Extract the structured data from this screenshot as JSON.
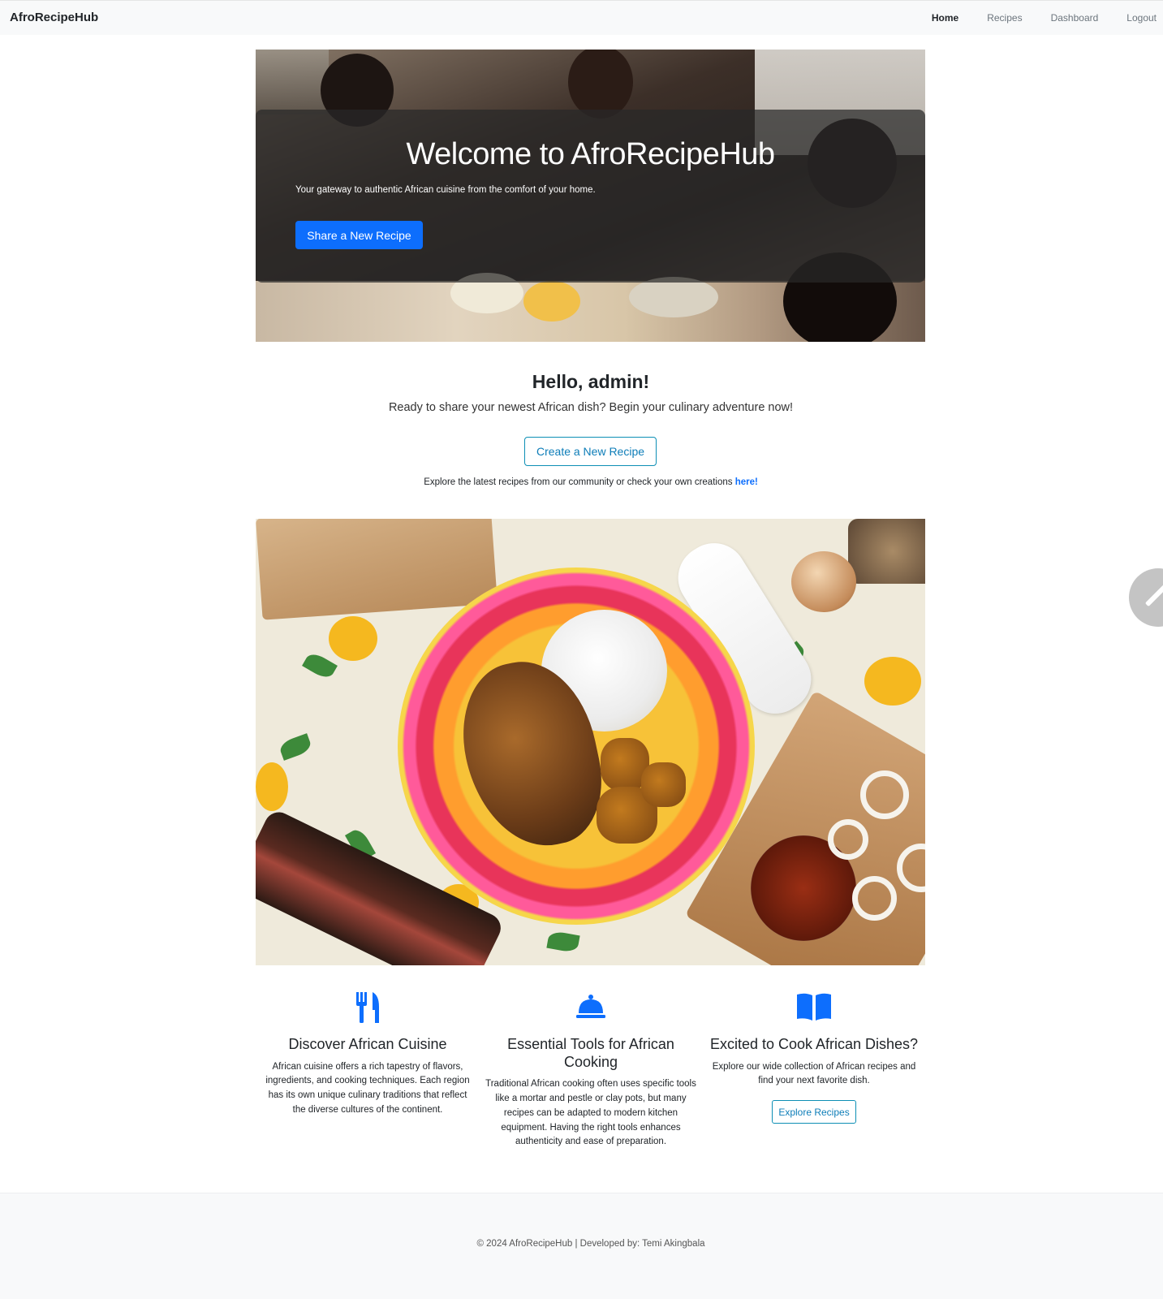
{
  "navbar": {
    "brand": "AfroRecipeHub",
    "links": [
      {
        "label": "Home",
        "active": true
      },
      {
        "label": "Recipes",
        "active": false
      },
      {
        "label": "Dashboard",
        "active": false
      },
      {
        "label": "Logout",
        "active": false
      }
    ]
  },
  "hero": {
    "title": "Welcome to AfroRecipeHub",
    "subtitle": "Your gateway to authentic African cuisine from the comfort of your home.",
    "button_label": "Share a New Recipe"
  },
  "greeting": {
    "heading": "Hello, admin!",
    "lead": "Ready to share your newest African dish? Begin your culinary adventure now!",
    "create_button": "Create a New Recipe",
    "explore_text": "Explore the latest recipes from our community or check your own creations ",
    "explore_link": "here!"
  },
  "features": [
    {
      "icon": "utensils-icon",
      "title": "Discover African Cuisine",
      "body": "African cuisine offers a rich tapestry of flavors, ingredients, and cooking techniques. Each region has its own unique culinary traditions that reflect the diverse cultures of the continent."
    },
    {
      "icon": "cloche-icon",
      "title": "Essential Tools for African Cooking",
      "body": "Traditional African cooking often uses specific tools like a mortar and pestle or clay pots, but many recipes can be adapted to modern kitchen equipment. Having the right tools enhances authenticity and ease of preparation."
    },
    {
      "icon": "open-book-icon",
      "title": "Excited to Cook African Dishes?",
      "body": "Explore our wide collection of African recipes and find your next favorite dish.",
      "button_label": "Explore Recipes"
    }
  ],
  "footer": {
    "text": "© 2024 AfroRecipeHub | Developed by: Temi Akingbala"
  },
  "colors": {
    "primary": "#0d6efd",
    "outline": "#0d8fb5",
    "navbar_bg": "#f8f9fa",
    "footer_bg": "#f8f9fa"
  }
}
